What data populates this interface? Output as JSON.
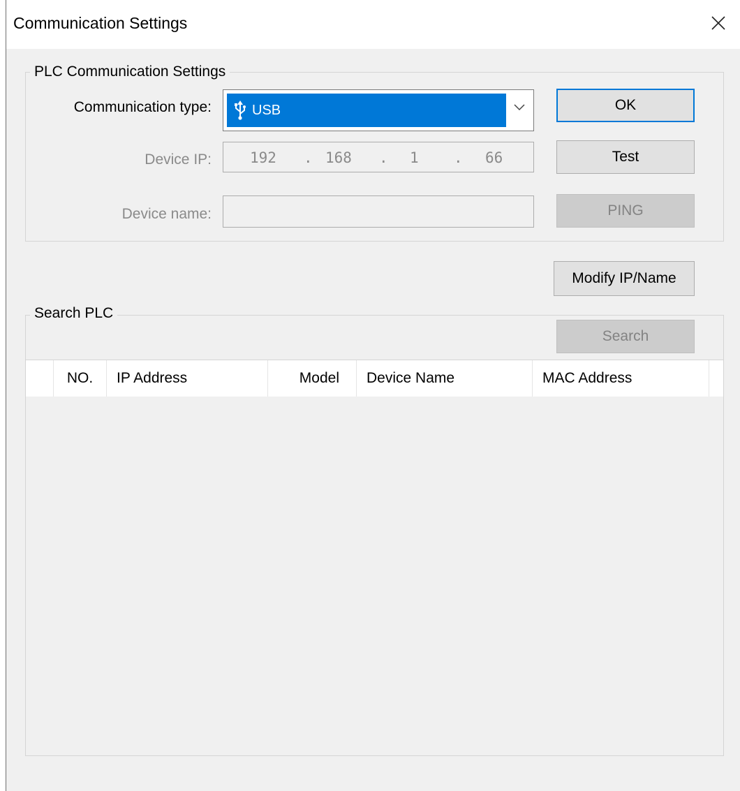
{
  "window": {
    "title": "Communication Settings"
  },
  "plc_group": {
    "legend": "PLC Communication Settings",
    "comm_type_label": "Communication type:",
    "comm_type_value": "USB",
    "device_ip_label": "Device IP:",
    "ip": [
      "192",
      "168",
      "1",
      "66"
    ],
    "ip_separator": ".",
    "device_name_label": "Device name:",
    "device_name_value": ""
  },
  "buttons": {
    "ok": "OK",
    "test": "Test",
    "ping": "PING",
    "modify": "Modify IP/Name",
    "search": "Search"
  },
  "search_group": {
    "legend": "Search PLC",
    "columns": [
      "NO.",
      "IP Address",
      "Model",
      "Device Name",
      "MAC Address"
    ],
    "rows": []
  },
  "colors": {
    "accent": "#0078d7",
    "disabled_text": "#8a8a8a"
  },
  "icons": {
    "combo_icon": "usb-icon",
    "combo_arrow": "chevron-down-icon",
    "close": "close-icon"
  }
}
